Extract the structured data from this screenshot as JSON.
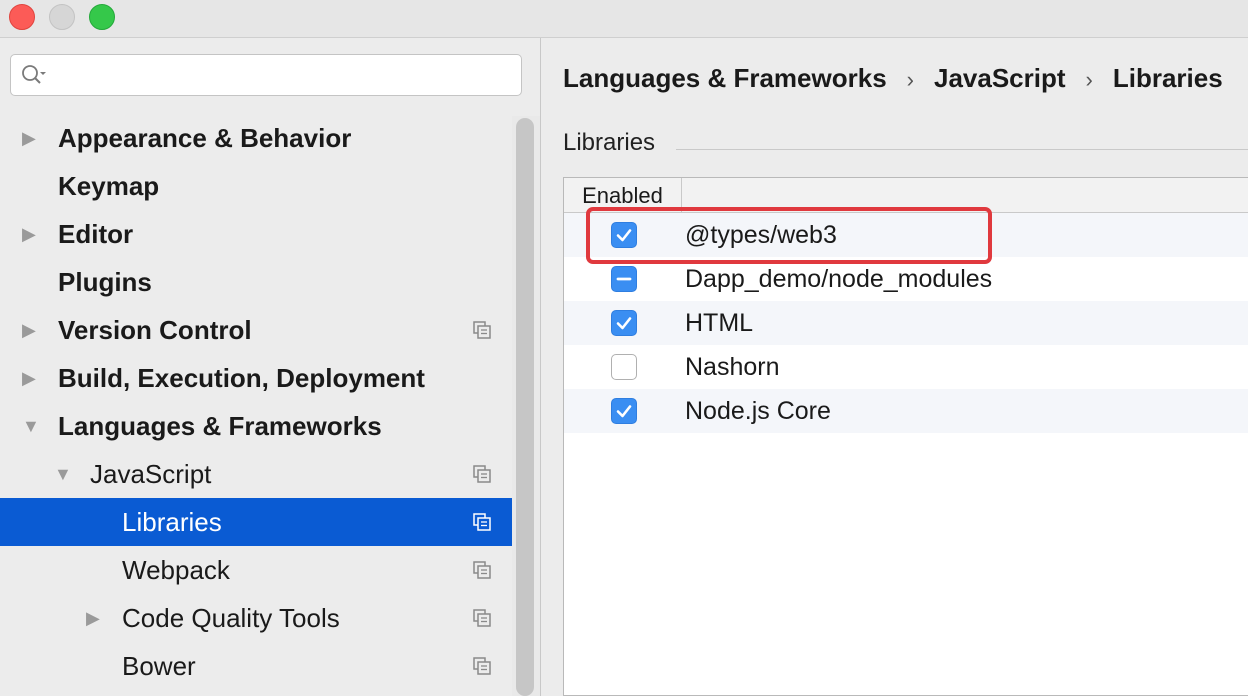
{
  "window": {
    "traffic_lights": [
      "close",
      "minimize",
      "zoom"
    ]
  },
  "sidebar": {
    "search": {
      "value": "",
      "placeholder": ""
    },
    "items": [
      {
        "label": "Appearance & Behavior",
        "bold": true,
        "arrow": "right"
      },
      {
        "label": "Keymap",
        "bold": true,
        "arrow": ""
      },
      {
        "label": "Editor",
        "bold": true,
        "arrow": "right"
      },
      {
        "label": "Plugins",
        "bold": true,
        "arrow": ""
      },
      {
        "label": "Version Control",
        "bold": true,
        "arrow": "right",
        "project_icon": true
      },
      {
        "label": "Build, Execution, Deployment",
        "bold": true,
        "arrow": "right"
      },
      {
        "label": "Languages & Frameworks",
        "bold": true,
        "arrow": "down"
      },
      {
        "label": "JavaScript",
        "bold": false,
        "arrow": "down",
        "project_icon": true
      },
      {
        "label": "Libraries",
        "bold": false,
        "arrow": "",
        "project_icon": true,
        "selected": true
      },
      {
        "label": "Webpack",
        "bold": false,
        "arrow": "",
        "project_icon": true
      },
      {
        "label": "Code Quality Tools",
        "bold": false,
        "arrow": "right",
        "project_icon": true
      },
      {
        "label": "Bower",
        "bold": false,
        "arrow": "",
        "project_icon": true
      }
    ]
  },
  "main": {
    "breadcrumb": [
      "Languages & Frameworks",
      "JavaScript",
      "Libraries"
    ],
    "breadcrumb_separator": "›",
    "section_title": "Libraries",
    "table": {
      "header": "Enabled",
      "rows": [
        {
          "name": "@types/web3",
          "state": "checked",
          "highlighted": true
        },
        {
          "name": "Dapp_demo/node_modules",
          "state": "indeterminate"
        },
        {
          "name": "HTML",
          "state": "checked"
        },
        {
          "name": "Nashorn",
          "state": "unchecked"
        },
        {
          "name": "Node.js Core",
          "state": "checked"
        }
      ]
    }
  },
  "colors": {
    "selection": "#0a5bd3",
    "checkbox": "#3a8ef2",
    "annotation": "#e0393e"
  }
}
